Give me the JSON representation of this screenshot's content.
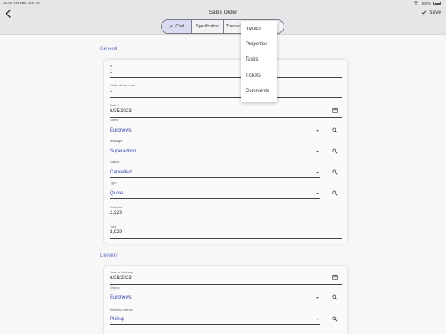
{
  "status_bar": {
    "time": "10:50 PM",
    "date": "Wed Jun 28",
    "battery": "100%"
  },
  "header": {
    "title": "Sales Order",
    "save_label": "Save"
  },
  "tabs": [
    {
      "label": "Card",
      "active": true
    },
    {
      "label": "Specification",
      "active": false
    },
    {
      "label": "Transac",
      "active": false
    }
  ],
  "menu": {
    "items": [
      "Invoice",
      "Properties",
      "Tasks",
      "Tickets",
      "Comments"
    ]
  },
  "general": {
    "title": "General",
    "fields": {
      "id": {
        "label": "Id",
        "value": "1"
      },
      "code": {
        "label": "Sales Order code",
        "value": "1"
      },
      "date": {
        "label": "Date *",
        "value": "6/25/2023"
      },
      "client": {
        "label": "Client",
        "value": "Euronews"
      },
      "manager": {
        "label": "Manager",
        "value": "Superadmin"
      },
      "status": {
        "label": "Status",
        "value": "Cancelled"
      },
      "type": {
        "label": "Type",
        "value": "Quote"
      },
      "subtotal": {
        "label": "Subtotal",
        "value": "2,929"
      },
      "total": {
        "label": "Total",
        "value": "2,929"
      }
    }
  },
  "delivery": {
    "title": "Delivery",
    "fields": {
      "term": {
        "label": "Term of delivery",
        "value": "6/28/2023"
      },
      "ship_to": {
        "label": "Ship to",
        "value": "Euronews"
      },
      "method": {
        "label": "Delivery method",
        "value": "Pickup"
      }
    }
  },
  "colors": {
    "accent": "#5c6bc0",
    "link": "#3949ab",
    "header_bg": "#e6e6e9",
    "active_tab": "#d9dcf0"
  }
}
